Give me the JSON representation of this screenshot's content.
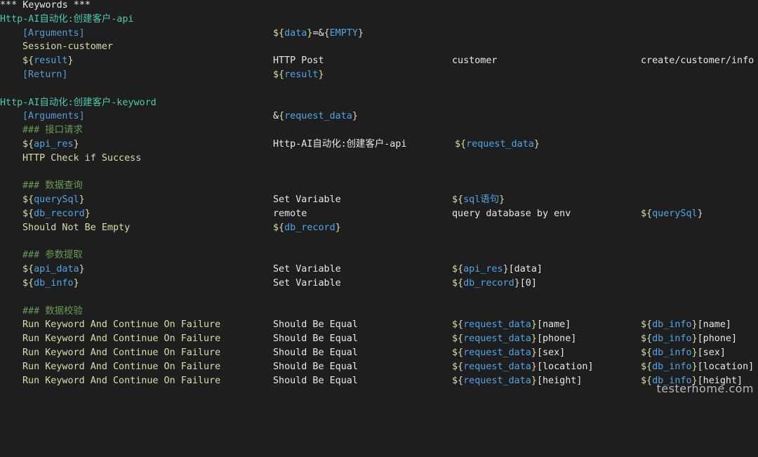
{
  "header": "*** Keywords ***",
  "keyword1": {
    "name": "Http-AI自动化:创建客户-api",
    "args_setting": "[Arguments]",
    "args_value": [
      "data",
      "EMPTY"
    ],
    "step2_kw": "Session-customer",
    "result_var": "result",
    "http_post": "HTTP Post",
    "customer": "customer",
    "path": "create/customer/info",
    "return_setting": "[Return]",
    "return_var": "result"
  },
  "keyword2": {
    "name": "Http-AI自动化:创建客户-keyword",
    "args_setting": "[Arguments]",
    "request_data": "request_data",
    "comment_api": "### 接口请求",
    "api_res": "api_res",
    "call_kw": "Http-AI自动化:创建客户-api",
    "http_check": "HTTP Check if Success",
    "comment_db": "### 数据查询",
    "query_sql": "querySql",
    "set_variable": "Set Variable",
    "sql_stmt": "sql语句",
    "db_record": "db_record",
    "remote": "remote",
    "query_by_env": "query database by env",
    "should_not_empty": "Should Not Be Empty",
    "comment_extract": "### 参数提取",
    "api_data": "api_data",
    "api_data_index": "[data]",
    "db_info": "db_info",
    "db_record_index": "[0]",
    "comment_verify": "### 数据校验",
    "run_kw": "Run Keyword And Continue On Failure",
    "should_equal": "Should Be Equal",
    "fields": [
      "[name]",
      "[phone]",
      "[sex]",
      "[location]",
      "[height]"
    ]
  },
  "watermark": "testerhome.com"
}
